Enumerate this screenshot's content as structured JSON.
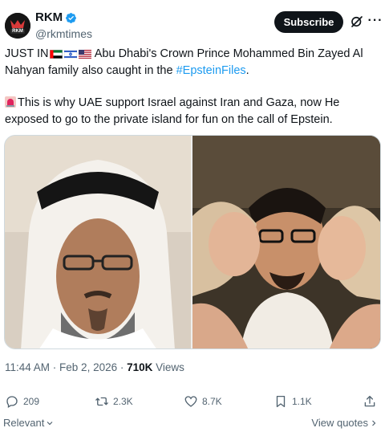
{
  "author": {
    "display_name": "RKM",
    "handle": "@rkmtimes",
    "avatar_text": "RKM",
    "verified": true
  },
  "header": {
    "subscribe_label": "Subscribe",
    "more_icon": "more-horizontal-icon",
    "grok_icon": "grok-icon"
  },
  "post": {
    "line1_prefix": "JUST IN",
    "line1_text": " Abu Dhabi's Crown Prince Mohammed Bin Zayed Al Nahyan family also caught in the ",
    "hashtag": "#EpsteinFiles",
    "line1_suffix": ".",
    "line2_text": "This is why UAE support Israel against Iran and Gaza, now He exposed to go to the private island for fun on the call of Epstein.",
    "flags": [
      "uae-flag",
      "israel-flag",
      "usa-flag"
    ],
    "siren_icon": "rotating-light-icon"
  },
  "media": {
    "left_photo": "photo-man-white-headdress",
    "right_photo": "photo-man-with-two-women"
  },
  "meta": {
    "time": "11:44 AM",
    "separator1": " · ",
    "date": "Feb 2, 2026",
    "separator2": " · ",
    "views_count": "710K",
    "views_label": " Views"
  },
  "actions": {
    "replies": "209",
    "reposts": "2.3K",
    "likes": "8.7K",
    "bookmarks": "1.1K"
  },
  "footer": {
    "sort_label": "Relevant",
    "view_quotes_label": "View quotes"
  },
  "colors": {
    "text": "#0f1419",
    "secondary": "#536471",
    "accent": "#1d9bf0",
    "verified": "#1d9bf0"
  }
}
